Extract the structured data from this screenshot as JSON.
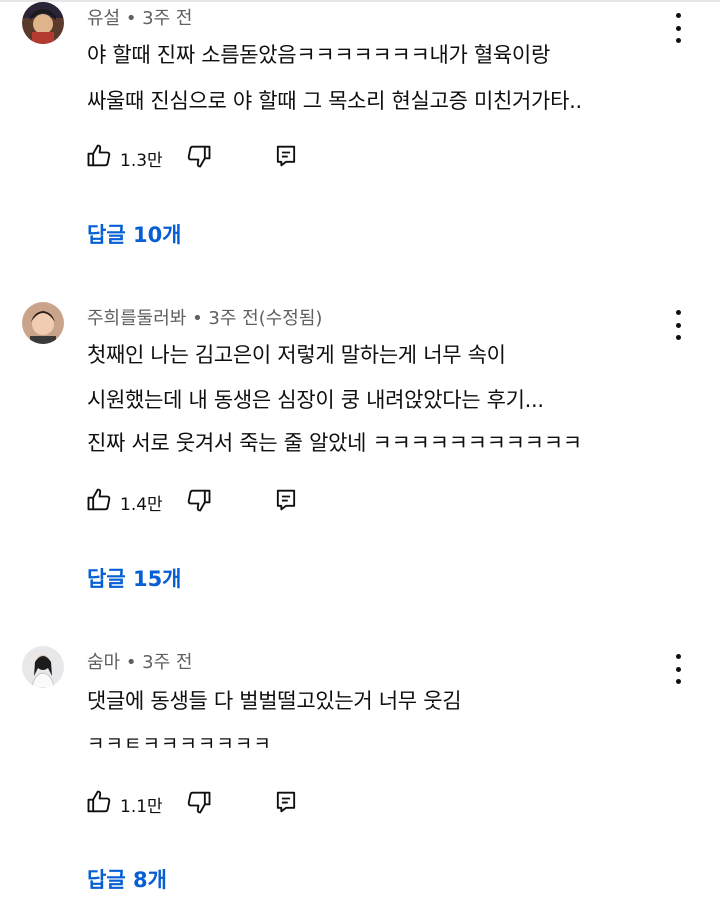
{
  "comments": [
    {
      "meta": "유설 • 3주 전",
      "lines": [
        "야 할때 진짜 소름돋았음ㅋㅋㅋㅋㅋㅋㅋ내가 혈육이랑",
        "싸울때 진심으로 야 할때 그 목소리 현실고증 미친거가타.."
      ],
      "likes": "1.3만",
      "replies": "답글 10개"
    },
    {
      "meta": "주희를둘러봐 • 3주 전(수정됨)",
      "lines": [
        "첫째인 나는 김고은이 저렇게 말하는게 너무 속이",
        "시원했는데 내 동생은 심장이 쿵 내려앉았다는 후기...",
        "진짜 서로 웃겨서 죽는 줄 알았네 ㅋㅋㅋㅋㅋㅋㅋㅋㅋㅋㅋ"
      ],
      "likes": "1.4만",
      "replies": "답글 15개"
    },
    {
      "meta": "숨마 • 3주 전",
      "lines": [
        "댓글에 동생들 다 벌벌떨고있는거 너무 웃김",
        "ㅋㅋㅌㅋㅋㅋㅋㅋㅋㅋ"
      ],
      "likes": "1.1만",
      "replies": "답글 8개"
    }
  ],
  "icons": {
    "like": "thumbs-up-icon",
    "dislike": "thumbs-down-icon",
    "reply": "reply-icon",
    "more": "more-vertical-icon"
  },
  "colors": {
    "replies_link": "#065fd4",
    "meta_text": "#606060",
    "body_text": "#0f0f0f"
  }
}
